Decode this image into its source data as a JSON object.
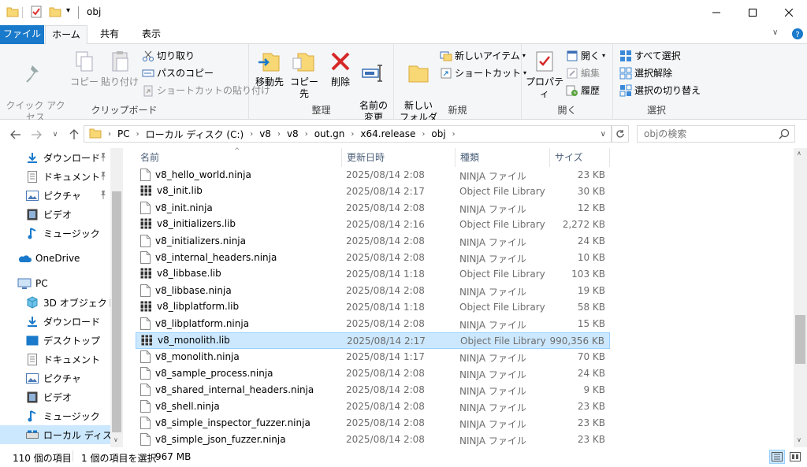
{
  "window": {
    "title": "obj",
    "minimize": "—",
    "maximize": "☐",
    "close": "✕"
  },
  "tabs": {
    "file": "ファイル",
    "home": "ホーム",
    "share": "共有",
    "view": "表示"
  },
  "ribbon": {
    "clipboard": {
      "label": "クリップボード",
      "pin_quick_access": "クイック アクセス\nにピン留めする",
      "copy": "コピー",
      "paste": "貼り付け",
      "cut": "切り取り",
      "copy_path": "パスのコピー",
      "paste_shortcut": "ショートカットの貼り付け"
    },
    "organize": {
      "label": "整理",
      "move_to": "移動先",
      "copy_to": "コピー先",
      "delete": "削除",
      "rename": "名前の\n変更"
    },
    "new": {
      "label": "新規",
      "new_folder": "新しい\nフォルダー",
      "new_item": "新しいアイテム",
      "shortcut": "ショートカット"
    },
    "open": {
      "label": "開く",
      "properties": "プロパティ",
      "open": "開く",
      "edit": "編集",
      "history": "履歴"
    },
    "select": {
      "label": "選択",
      "select_all": "すべて選択",
      "select_none": "選択解除",
      "invert": "選択の切り替え"
    }
  },
  "address": {
    "crumbs": [
      "PC",
      "ローカル ディスク (C:)",
      "v8",
      "v8",
      "out.gn",
      "x64.release",
      "obj"
    ],
    "search_placeholder": "objの検索"
  },
  "navpane": {
    "items": [
      {
        "label": "ダウンロード",
        "icon": "download-icon",
        "pinned": true
      },
      {
        "label": "ドキュメント",
        "icon": "document-icon",
        "pinned": true
      },
      {
        "label": "ピクチャ",
        "icon": "pictures-icon",
        "pinned": true
      },
      {
        "label": "ビデオ",
        "icon": "video-icon",
        "pinned": false
      },
      {
        "label": "ミュージック",
        "icon": "music-icon",
        "pinned": false
      },
      {
        "label": "OneDrive",
        "icon": "onedrive-icon",
        "pinned": false
      },
      {
        "label": "PC",
        "icon": "pc-icon",
        "pinned": false
      },
      {
        "label": "3D オブジェクト",
        "icon": "3d-objects-icon",
        "pinned": false
      },
      {
        "label": "ダウンロード",
        "icon": "download-icon",
        "pinned": false
      },
      {
        "label": "デスクトップ",
        "icon": "desktop-icon",
        "pinned": false
      },
      {
        "label": "ドキュメント",
        "icon": "document-icon",
        "pinned": false
      },
      {
        "label": "ピクチャ",
        "icon": "pictures-icon",
        "pinned": false
      },
      {
        "label": "ビデオ",
        "icon": "video-icon",
        "pinned": false
      },
      {
        "label": "ミュージック",
        "icon": "music-icon",
        "pinned": false
      },
      {
        "label": "ローカル ディスク (C",
        "icon": "drive-icon",
        "pinned": false
      }
    ]
  },
  "filelist": {
    "columns": {
      "name": "名前",
      "date": "更新日時",
      "type": "種類",
      "size": "サイズ"
    },
    "rows": [
      {
        "name": "v8_hello_world.ninja",
        "date": "2025/08/14 2:08",
        "type": "NINJA ファイル",
        "size": "23 KB",
        "kind": "ninja"
      },
      {
        "name": "v8_init.lib",
        "date": "2025/08/14 2:17",
        "type": "Object File Library",
        "size": "30 KB",
        "kind": "lib"
      },
      {
        "name": "v8_init.ninja",
        "date": "2025/08/14 2:08",
        "type": "NINJA ファイル",
        "size": "12 KB",
        "kind": "ninja"
      },
      {
        "name": "v8_initializers.lib",
        "date": "2025/08/14 2:16",
        "type": "Object File Library",
        "size": "2,272 KB",
        "kind": "lib"
      },
      {
        "name": "v8_initializers.ninja",
        "date": "2025/08/14 2:08",
        "type": "NINJA ファイル",
        "size": "24 KB",
        "kind": "ninja"
      },
      {
        "name": "v8_internal_headers.ninja",
        "date": "2025/08/14 2:08",
        "type": "NINJA ファイル",
        "size": "10 KB",
        "kind": "ninja"
      },
      {
        "name": "v8_libbase.lib",
        "date": "2025/08/14 1:18",
        "type": "Object File Library",
        "size": "103 KB",
        "kind": "lib"
      },
      {
        "name": "v8_libbase.ninja",
        "date": "2025/08/14 2:08",
        "type": "NINJA ファイル",
        "size": "19 KB",
        "kind": "ninja"
      },
      {
        "name": "v8_libplatform.lib",
        "date": "2025/08/14 1:18",
        "type": "Object File Library",
        "size": "58 KB",
        "kind": "lib"
      },
      {
        "name": "v8_libplatform.ninja",
        "date": "2025/08/14 2:08",
        "type": "NINJA ファイル",
        "size": "15 KB",
        "kind": "ninja"
      },
      {
        "name": "v8_monolith.lib",
        "date": "2025/08/14 2:17",
        "type": "Object File Library",
        "size": "990,356 KB",
        "kind": "lib",
        "selected": true
      },
      {
        "name": "v8_monolith.ninja",
        "date": "2025/08/14 1:17",
        "type": "NINJA ファイル",
        "size": "70 KB",
        "kind": "ninja"
      },
      {
        "name": "v8_sample_process.ninja",
        "date": "2025/08/14 2:08",
        "type": "NINJA ファイル",
        "size": "24 KB",
        "kind": "ninja"
      },
      {
        "name": "v8_shared_internal_headers.ninja",
        "date": "2025/08/14 2:08",
        "type": "NINJA ファイル",
        "size": "9 KB",
        "kind": "ninja"
      },
      {
        "name": "v8_shell.ninja",
        "date": "2025/08/14 2:08",
        "type": "NINJA ファイル",
        "size": "23 KB",
        "kind": "ninja"
      },
      {
        "name": "v8_simple_inspector_fuzzer.ninja",
        "date": "2025/08/14 2:08",
        "type": "NINJA ファイル",
        "size": "23 KB",
        "kind": "ninja"
      },
      {
        "name": "v8_simple_json_fuzzer.ninja",
        "date": "2025/08/14 2:08",
        "type": "NINJA ファイル",
        "size": "23 KB",
        "kind": "ninja"
      }
    ]
  },
  "status": {
    "count": "110 個の項目",
    "selection": "1 個の項目を選択",
    "selection_size": "967 MB"
  },
  "colors": {
    "accent": "#1979ca",
    "selection": "#cce8ff",
    "folder": "#f8d775"
  }
}
